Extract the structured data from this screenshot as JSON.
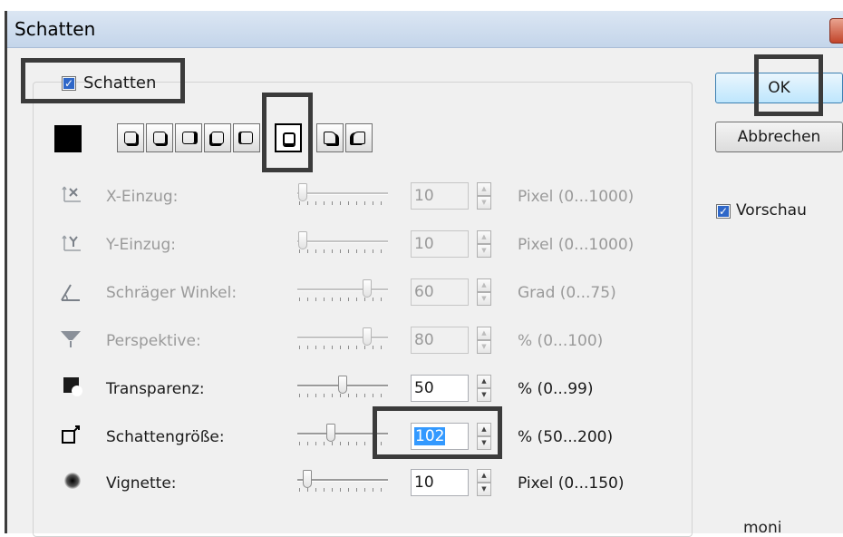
{
  "dialog": {
    "title": "Schatten"
  },
  "shadow_toggle": {
    "label": "Schatten",
    "checked": true
  },
  "shadow_color": "#000000",
  "shape_buttons": [
    {
      "icon": "shadow-style-1-icon"
    },
    {
      "icon": "shadow-style-2-icon"
    },
    {
      "icon": "shadow-style-3-icon"
    },
    {
      "icon": "shadow-style-4-icon"
    },
    {
      "icon": "shadow-style-5-icon",
      "selected": true
    },
    {
      "icon": "shadow-style-6-icon"
    },
    {
      "icon": "shadow-style-7-icon"
    }
  ],
  "settings": [
    {
      "icon": "x-offset-icon",
      "label": "X-Einzug:",
      "value": "10",
      "range": "Pixel (0...1000)",
      "enabled": false,
      "level": 0.01
    },
    {
      "icon": "y-offset-icon",
      "label": "Y-Einzug:",
      "value": "10",
      "range": "Pixel (0...1000)",
      "enabled": false,
      "level": 0.01
    },
    {
      "icon": "angle-icon",
      "label": "Schräger Winkel:",
      "value": "60",
      "range": "Grad (0...75)",
      "enabled": false,
      "level": 0.8
    },
    {
      "icon": "perspective-icon",
      "label": "Perspektive:",
      "value": "80",
      "range": "% (0...100)",
      "enabled": false,
      "level": 0.8
    },
    {
      "icon": "transparency-icon",
      "label": "Transparenz:",
      "value": "50",
      "range": "% (0...99)",
      "enabled": true,
      "level": 0.5
    },
    {
      "icon": "shadow-size-icon",
      "label": "Schattengröße:",
      "value": "102",
      "range": "% (50...200)",
      "enabled": true,
      "level": 0.35,
      "selected": true
    },
    {
      "icon": "vignette-icon",
      "label": "Vignette:",
      "value": "10",
      "range": "Pixel (0...150)",
      "enabled": true,
      "level": 0.07
    }
  ],
  "buttons": {
    "ok": "OK",
    "cancel": "Abbrechen"
  },
  "preview": {
    "label": "Vorschau",
    "checked": true
  },
  "footer_text": "moni"
}
